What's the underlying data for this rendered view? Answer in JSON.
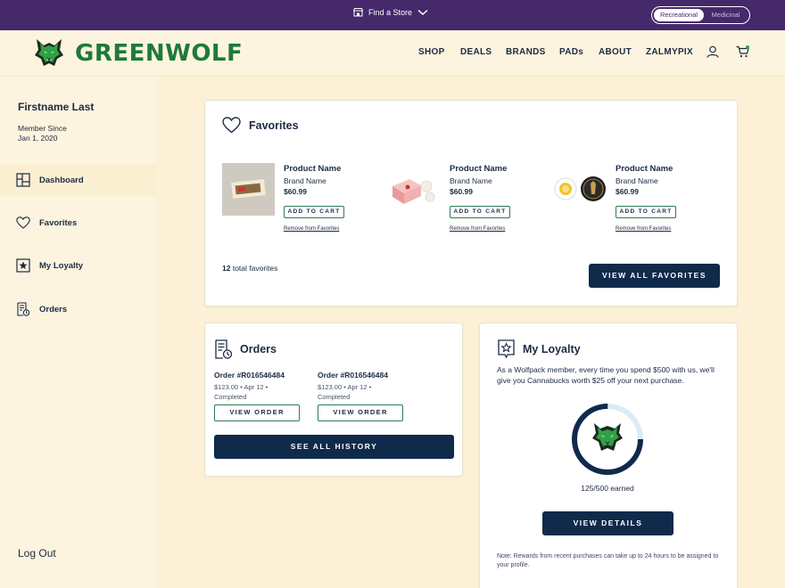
{
  "topbar": {
    "find_store": "Find a Store",
    "toggle": [
      "Recreational",
      "Medicinal"
    ],
    "active_toggle": "Recreational"
  },
  "header": {
    "brand": "GREENWOLF",
    "nav": [
      "SHOP",
      "DEALS",
      "BRANDS",
      "PADs",
      "ABOUT",
      "ZALMYPIX"
    ],
    "icons": [
      "user-icon",
      "cart-icon"
    ]
  },
  "sidebar": {
    "user_name": "Firstname Last",
    "member_since_label": "Member Since",
    "member_since_date": "Jan 1, 2020",
    "items": [
      {
        "label": "Dashboard",
        "icon": "dashboard-icon",
        "active": true
      },
      {
        "label": "Favorites",
        "icon": "heart-icon",
        "active": false
      },
      {
        "label": "My Loyalty",
        "icon": "star-badge-icon",
        "active": false
      },
      {
        "label": "Orders",
        "icon": "receipt-icon",
        "active": false
      }
    ],
    "logout": "Log Out"
  },
  "favorites": {
    "title": "Favorites",
    "products": [
      {
        "name": "Product Name",
        "brand": "Brand Name",
        "price": "$60.99",
        "add_label": "ADD TO CART",
        "remove_label": "Remove from Favorites"
      },
      {
        "name": "Product Name",
        "brand": "Brand Name",
        "price": "$60.99",
        "add_label": "ADD TO CART",
        "remove_label": "Remove from Favorites"
      },
      {
        "name": "Product Name",
        "brand": "Brand Name",
        "price": "$60.99",
        "add_label": "ADD TO CART",
        "remove_label": "Remove from Favorites"
      }
    ],
    "total_count": "12",
    "total_suffix": "total favorites",
    "view_all": "VIEW ALL FAVORITES"
  },
  "orders": {
    "title": "Orders",
    "items": [
      {
        "number": "Order #R016546484",
        "meta1": "$123.00  •  Apr 12  •",
        "meta2": "Completed",
        "button": "VIEW ORDER"
      },
      {
        "number": "Order #R016546484",
        "meta1": "$123.00  •  Apr 12  •",
        "meta2": "Completed",
        "button": "VIEW ORDER"
      }
    ],
    "see_all": "SEE ALL HISTORY"
  },
  "loyalty": {
    "title": "My Loyalty",
    "description": "As a Wolfpack member, every time you spend $500 with us, we'll give you Cannabucks worth $25 off your next purchase.",
    "earned_text": "125/500 earned",
    "progress_fraction": 0.25,
    "view_details": "VIEW DETAILS",
    "note": "Note: Rewards from recent purchases can take up to 24 hours to be assigned to your profile."
  },
  "colors": {
    "topbar": "#45296b",
    "brand_green": "#1f7a38",
    "navy": "#0f2a4a",
    "cream": "#fdf4df"
  }
}
